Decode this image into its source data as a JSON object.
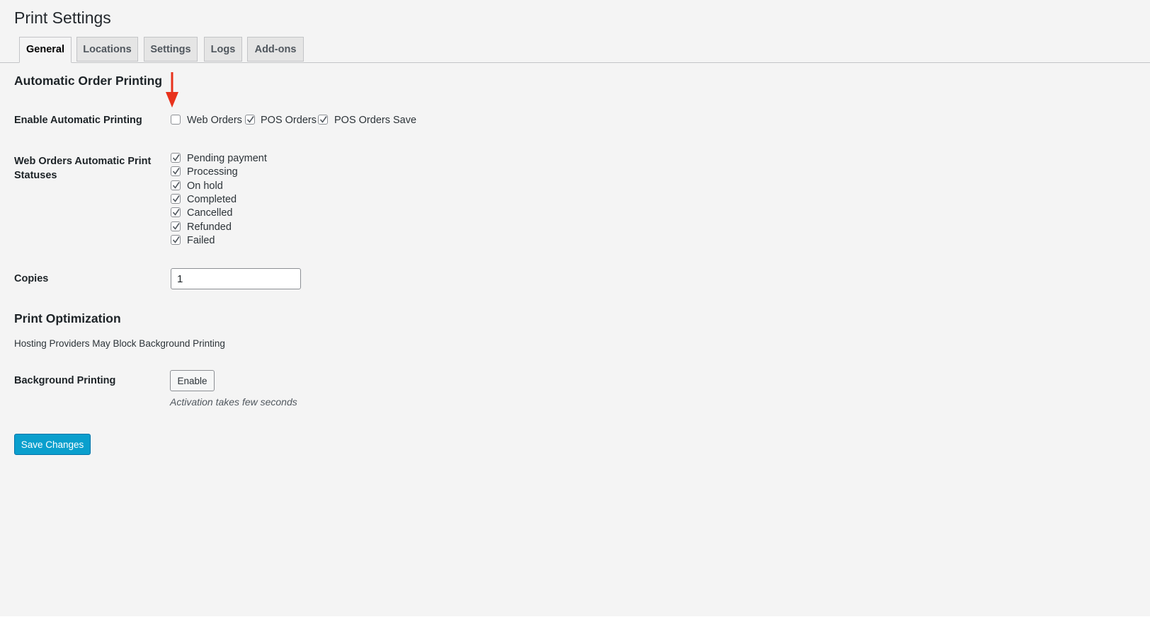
{
  "page": {
    "title": "Print Settings"
  },
  "tabs": [
    {
      "label": "General",
      "active": true
    },
    {
      "label": "Locations",
      "active": false
    },
    {
      "label": "Settings",
      "active": false
    },
    {
      "label": "Logs",
      "active": false
    },
    {
      "label": "Add-ons",
      "active": false
    }
  ],
  "automatic": {
    "section_title": "Automatic Order Printing",
    "enable_label": "Enable Automatic Printing",
    "enable_options": [
      {
        "label": "Web Orders",
        "checked": false
      },
      {
        "label": "POS Orders",
        "checked": true
      },
      {
        "label": "POS Orders Save",
        "checked": true
      }
    ],
    "statuses_label": "Web Orders Automatic Print Statuses",
    "statuses": [
      {
        "label": "Pending payment",
        "checked": true
      },
      {
        "label": "Processing",
        "checked": true
      },
      {
        "label": "On hold",
        "checked": true
      },
      {
        "label": "Completed",
        "checked": true
      },
      {
        "label": "Cancelled",
        "checked": true
      },
      {
        "label": "Refunded",
        "checked": true
      },
      {
        "label": "Failed",
        "checked": true
      }
    ],
    "copies_label": "Copies",
    "copies_value": "1"
  },
  "optimization": {
    "section_title": "Print Optimization",
    "description": "Hosting Providers May Block Background Printing",
    "background_label": "Background Printing",
    "enable_button": "Enable",
    "hint": "Activation takes few seconds"
  },
  "save_button": "Save Changes",
  "colors": {
    "primary": "#0a9fcd",
    "arrow": "#e8321c",
    "background": "#f4f4f4",
    "check": "#50575e"
  }
}
